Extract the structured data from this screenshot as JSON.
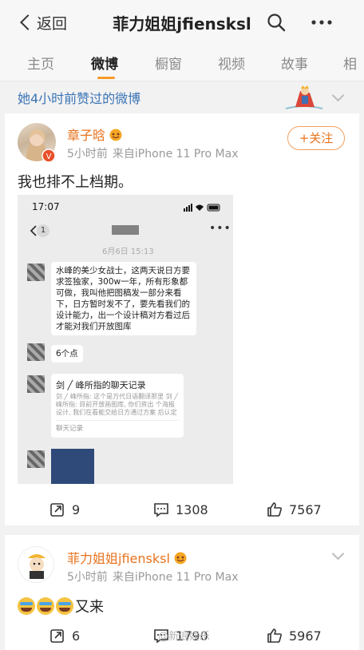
{
  "topbar": {
    "back_label": "返回",
    "title": "菲力姐姐jfiensksl"
  },
  "tabs": [
    "主页",
    "微博",
    "橱窗",
    "视频",
    "故事",
    "相"
  ],
  "liked_header": "她4小时前赞过的微博",
  "post1": {
    "username": "章子晗",
    "time": "5小时前",
    "source": "来自iPhone 11 Pro Max",
    "follow_label": "+关注",
    "text": "我也排不上档期。",
    "screenshot": {
      "status_time": "17:07",
      "unread_badge": "1",
      "date": "6月6日 15:13",
      "message1": "水峰的美少女战士，这两天说日方要\n求签独家，300w一年，所有形象都\n可做，我叫他把图稿发一部分来看\n下，日方暂时发不了，要先看我们的\n设计能力，出一个设计稿对方看过后\n才能对我们开放图库",
      "message2": "6个点",
      "card_title": "剑 ╱ 峰所指的聊天记录",
      "card_lines": "剑 ╱ 峰所指: 这个是万代日语翻译那里 剑 ╱ 峰所指: 目前开放画图库, 你们资出 个海报设计, 我们在看能交给日方通过方案 后认定独家授权能力, 然后图库全开放给你",
      "card_footer": "聊天记录"
    },
    "reposts": "9",
    "comments": "1308",
    "likes": "7567"
  },
  "post2": {
    "username": "菲力姐姐jfiensksl",
    "time": "5小时前",
    "source": "来自iPhone 11 Pro Max",
    "text": "又来",
    "reposts": "6",
    "comments": "1790",
    "likes": "5967"
  },
  "watermark": "@新浪娱乐"
}
